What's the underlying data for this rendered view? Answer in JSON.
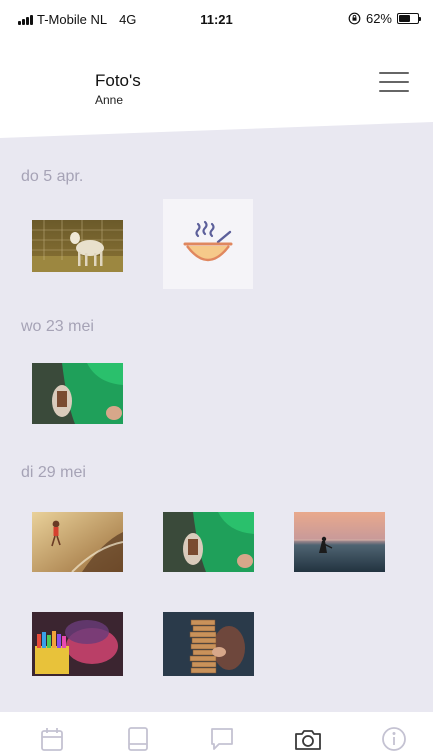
{
  "status_bar": {
    "carrier": "T-Mobile NL",
    "network": "4G",
    "time": "11:21",
    "battery_percent": "62%",
    "battery_level": 0.62
  },
  "header": {
    "title": "Foto's",
    "subtitle": "Anne",
    "menu_icon": "hamburger-menu-icon"
  },
  "sections": [
    {
      "date": "do 5 apr."
    },
    {
      "date": "wo 23 mei"
    },
    {
      "date": "di 29 mei"
    }
  ],
  "tab_bar": {
    "icons": [
      "calendar-icon",
      "book-icon",
      "chat-bubble-icon",
      "camera-icon",
      "info-icon"
    ],
    "active_icon": "camera-icon"
  },
  "colors": {
    "content_background": "#e9e8f1",
    "date_label": "#a6a3b6",
    "tab_inactive": "#c4c2d2",
    "tab_active": "#3a3a3a",
    "soup_bowl": "#f6c98a",
    "soup_accent": "#e0875f",
    "soup_steam": "#5c5f9a"
  }
}
